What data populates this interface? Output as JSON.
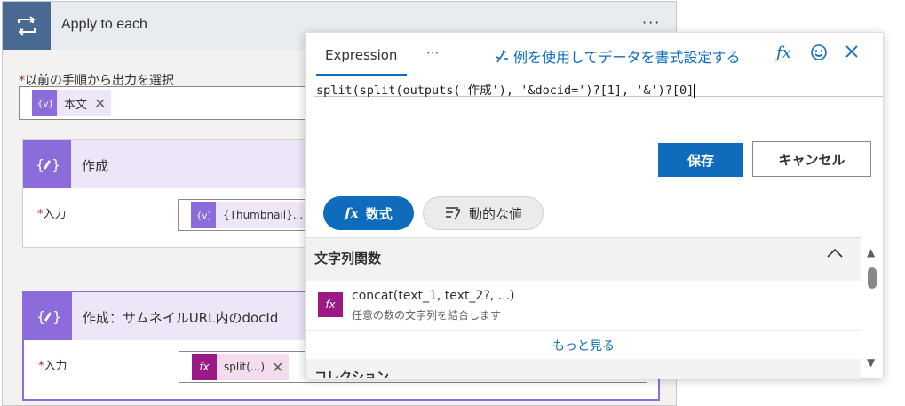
{
  "loop": {
    "title": "Apply to each",
    "more": "···",
    "select_label": "以前の手順から出力を選択",
    "required_mark": "*",
    "token_label": "本文",
    "token_remove": "✕"
  },
  "compose1": {
    "title": "作成",
    "input_label": "入力",
    "token_label": "{Thumbnail}..."
  },
  "compose2": {
    "title": "作成：サムネイルURL内のdocId",
    "input_label": "入力",
    "token_label": "split(...)",
    "token_remove": "✕"
  },
  "popup": {
    "tab_expression": "Expression",
    "tab_more": "···",
    "format_link": "例を使用してデータを書式設定する",
    "expression": "split(split(outputs('作成'), '&docid=')?[1], '&')?[0]",
    "save_button": "保存",
    "cancel_button": "キャンセル",
    "pill_expression": "数式",
    "pill_dynamic": "動的な値",
    "section_title": "文字列関数",
    "function_name": "concat(text_1, text_2?, ...)",
    "function_desc": "任意の数の文字列を結合します",
    "see_more": "もっと見る",
    "next_section": "コレクション"
  },
  "colors": {
    "accent": "#0f6cbd",
    "loop_icon": "#486991",
    "compose_icon": "#8c6cdb",
    "function_icon": "#9c1a85"
  }
}
